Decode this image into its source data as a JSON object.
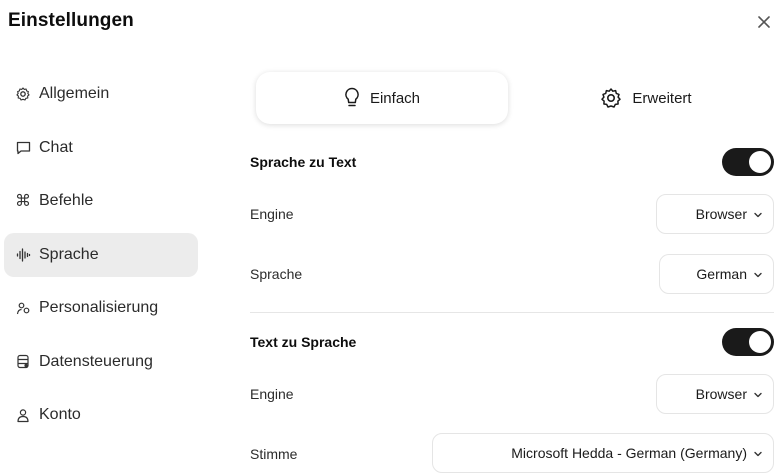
{
  "header": {
    "title": "Einstellungen",
    "close_icon": "close-icon"
  },
  "sidebar": {
    "items": [
      {
        "label": "Allgemein",
        "icon": "gear-icon",
        "active": false
      },
      {
        "label": "Chat",
        "icon": "chat-icon",
        "active": false
      },
      {
        "label": "Befehle",
        "icon": "command-icon",
        "active": false
      },
      {
        "label": "Sprache",
        "icon": "waveform-icon",
        "active": true
      },
      {
        "label": "Personalisierung",
        "icon": "people-icon",
        "active": false
      },
      {
        "label": "Datensteuerung",
        "icon": "database-icon",
        "active": false
      },
      {
        "label": "Konto",
        "icon": "user-icon",
        "active": false
      }
    ]
  },
  "tabs": [
    {
      "label": "Einfach",
      "icon": "lightbulb-icon",
      "active": true
    },
    {
      "label": "Erweitert",
      "icon": "cog-icon",
      "active": false
    }
  ],
  "stt": {
    "title": "Sprache zu Text",
    "enabled": true,
    "engine_label": "Engine",
    "engine_value": "Browser",
    "language_label": "Sprache",
    "language_value": "German"
  },
  "tts": {
    "title": "Text zu Sprache",
    "enabled": true,
    "engine_label": "Engine",
    "engine_value": "Browser",
    "voice_label": "Stimme",
    "voice_value": "Microsoft Hedda - German (Germany)"
  },
  "colors": {
    "toggle_on": "#1a1a1a",
    "active_bg": "#ececec",
    "border": "#e5e5e5"
  }
}
